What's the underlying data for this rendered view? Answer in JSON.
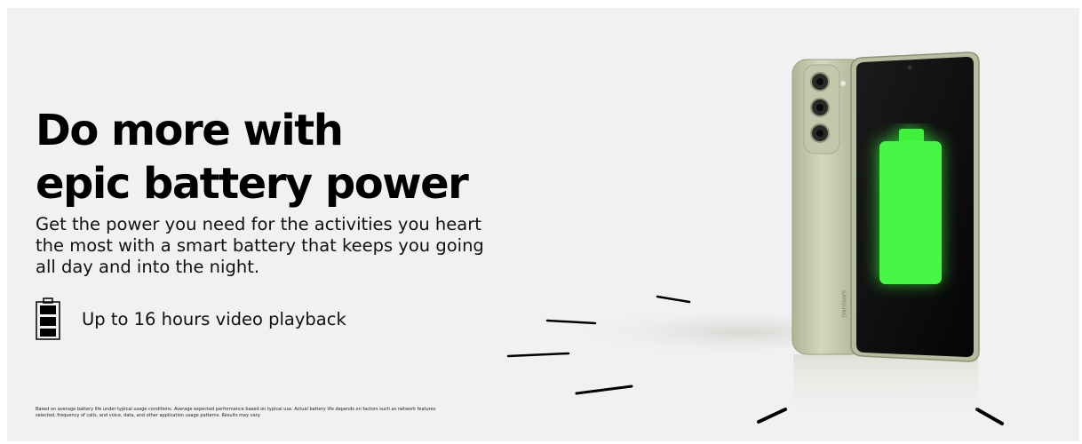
{
  "headline": {
    "line1": "Do more with",
    "line2": "epic battery power"
  },
  "subtext": "Get the power you need for the activities you heart the most with a smart battery that keeps you going all day and into the night.",
  "feature": {
    "icon": "battery-icon",
    "text": "Up to 16 hours video playback"
  },
  "disclaimer": "Based on average battery life under typical usage conditions. Average expected performance based on typical use. Actual battery life depends on factors such as network features selected, frequency of calls, and voice, data, and other application usage patterns. Results may vary.",
  "phone": {
    "brand_mark": "SAMSUNG",
    "body_color": "#c6ccb0",
    "screen_battery_color": "#3ef23c"
  },
  "colors": {
    "background": "#f1f1f1",
    "text": "#000000"
  }
}
